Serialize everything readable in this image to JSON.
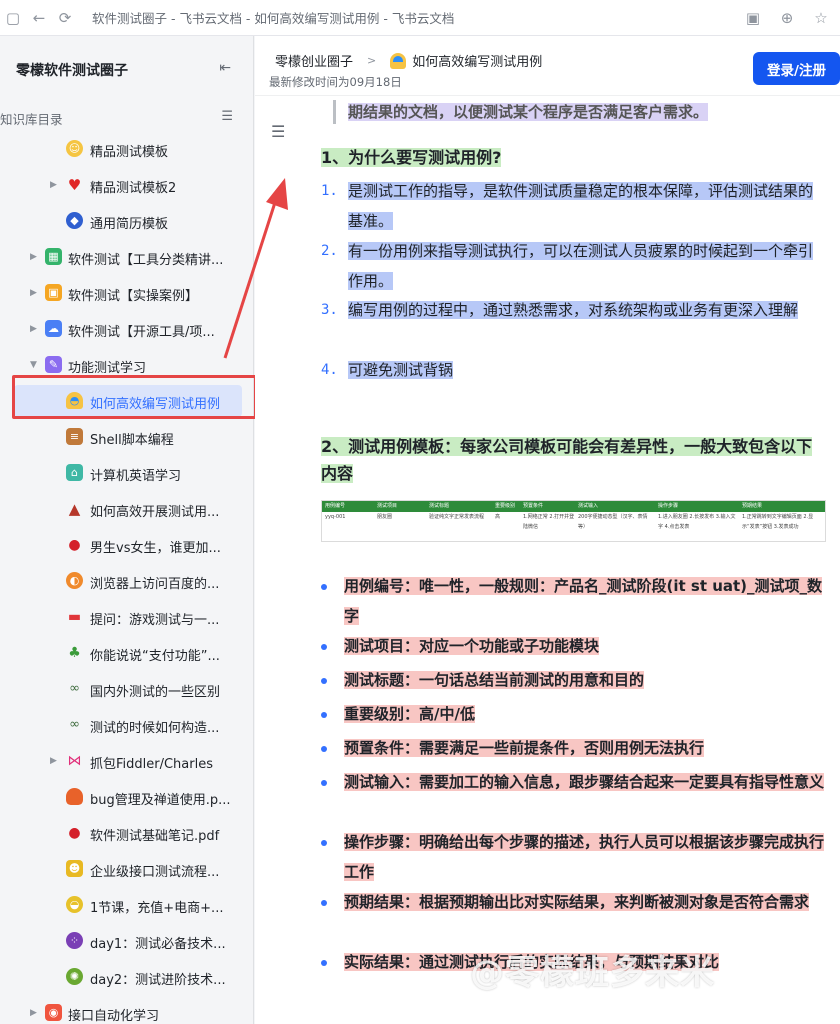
{
  "browser": {
    "title": "软件测试圈子 - 飞书云文档 - 如何高效编写测试用例 - 飞书云文档"
  },
  "sidebar": {
    "title": "零檬软件测试圈子",
    "section_label": "知识库目录",
    "items": [
      {
        "label": "精品测试模板",
        "icon": "smile-emoji-icon"
      },
      {
        "label": "精品测试模板2",
        "icon": "heart-icon"
      },
      {
        "label": "通用简历模板",
        "icon": "blue-badge-icon"
      },
      {
        "label": "软件测试【工具分类精讲...",
        "icon": "green-grid-icon"
      },
      {
        "label": "软件测试【实操案例】",
        "icon": "orange-box-icon"
      },
      {
        "label": "软件测试【开源工具/项...",
        "icon": "cloud-icon"
      },
      {
        "label": "功能测试学习",
        "icon": "purple-doc-icon"
      },
      {
        "label": "如何高效编写测试用例",
        "icon": "doc-dome-icon"
      },
      {
        "label": "Shell脚本编程",
        "icon": "book-stack-icon"
      },
      {
        "label": "计算机英语学习",
        "icon": "tent-icon"
      },
      {
        "label": "如何高效开展测试用...",
        "icon": "volcano-icon"
      },
      {
        "label": "男生vs女生，谁更加...",
        "icon": "cherry-icon"
      },
      {
        "label": "浏览器上访问百度的...",
        "icon": "orange-slice-icon"
      },
      {
        "label": "提问：游戏测试与一...",
        "icon": "car-icon"
      },
      {
        "label": "你能说说“支付功能”...",
        "icon": "palm-tree-icon"
      },
      {
        "label": "国内外测试的一些区别",
        "icon": "bike-icon"
      },
      {
        "label": "测试的时候如何构造...",
        "icon": "bike-icon"
      },
      {
        "label": "抓包Fiddler/Charles",
        "icon": "bow-icon"
      },
      {
        "label": "bug管理及禅道使用.p...",
        "icon": "blob-icon"
      },
      {
        "label": "软件测试基础笔记.pdf",
        "icon": "cherry-icon"
      },
      {
        "label": "企业级接口测试流程...",
        "icon": "robot-icon"
      },
      {
        "label": "1节课，充值+电商+...",
        "icon": "lemon-icon"
      },
      {
        "label": "day1：测试必备技术...",
        "icon": "grape-icon"
      },
      {
        "label": "day2：测试进阶技术...",
        "icon": "kiwi-icon"
      },
      {
        "label": "接口自动化学习",
        "icon": "red-circle-icon"
      }
    ]
  },
  "header": {
    "breadcrumb_parent": "零檬创业圈子",
    "breadcrumb_current": "如何高效编写测试用例",
    "modified": "最新修改时间为09月18日",
    "login_label": "登录/注册"
  },
  "doc": {
    "intro_line": "期结果的文档，以便测试某个程序是否满足客户需求。",
    "heading1": "1、为什么要写测试用例?",
    "reasons": [
      {
        "num": "1.",
        "text": "是测试工作的指导，是软件测试质量稳定的根本保障，评估测试结果的基准。"
      },
      {
        "num": "2.",
        "text": "有一份用例来指导测试执行，可以在测试人员疲累的时候起到一个牵引作用。"
      },
      {
        "num": "3.",
        "text": "编写用例的过程中，通过熟悉需求，对系统架构或业务有更深入理解"
      },
      {
        "num": "4.",
        "text": "可避免测试背锅"
      }
    ],
    "heading2": "2、测试用例模板：每家公司模板可能会有差异性，一般大致包含以下内容",
    "table_headers": [
      "用例编号",
      "测试项目",
      "测试标题",
      "重要级别",
      "预置条件",
      "测试输入",
      "操作步骤",
      "预期结果"
    ],
    "table_row": [
      "yyq-001",
      "朋友圈",
      "验证纯文字正常发表流程",
      "高",
      "1.网络正常 2.打开并登陆微信",
      "200字便捷动态型（汉字、表情等）",
      "1.进入朋友圈 2.长按发布 3.输入文字 4.点击发表",
      "1.正常跳转到文字编辑页面 2.显示“发表”按钮 3.发表成功"
    ],
    "fields": [
      "用例编号：唯一性，一般规则：产品名_测试阶段(it st uat)_测试项_数字",
      "测试项目：对应一个功能或子功能模块",
      "测试标题：一句话总结当前测试的用意和目的",
      "重要级别：高/中/低",
      "预置条件：需要满足一些前提条件，否则用例无法执行",
      "测试输入：需要加工的输入信息，跟步骤结合起来一定要具有指导性意义",
      "操作步骤：明确给出每个步骤的描述，执行人员可以根据该步骤完成执行工作",
      "预期结果：根据预期输出比对实际结果，来判断被测对象是否符合需求",
      "实际结果：通过测试执行后的实际结果，与预期结果对比"
    ],
    "watermark": "@零檬班多来米"
  },
  "colors": {
    "accent": "#3370ff",
    "login_button": "#1456f0",
    "annotation_red": "#e54545"
  }
}
